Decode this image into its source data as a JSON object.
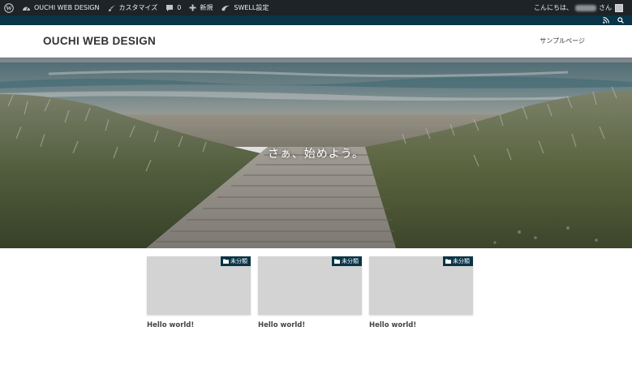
{
  "adminbar": {
    "wp_logo": "wordpress-icon",
    "site_name": "OUCHI WEB DESIGN",
    "customize": "カスタマイズ",
    "comments_count": "0",
    "new_label": "新規",
    "swell_settings": "SWELL設定",
    "greeting": "こんにちは、",
    "greeting_suffix": "さん"
  },
  "subbar": {
    "icons": [
      "rss-icon",
      "search-icon"
    ]
  },
  "header": {
    "site_title": "OUCHI WEB DESIGN",
    "nav": [
      "サンプルページ"
    ]
  },
  "hero": {
    "catchphrase": "さぁ、始めよう。"
  },
  "posts": [
    {
      "category": "未分類",
      "title": "Hello world!"
    },
    {
      "category": "未分類",
      "title": "Hello world!"
    },
    {
      "category": "未分類",
      "title": "Hello world!"
    }
  ],
  "colors": {
    "adminbar": "#1d2327",
    "accent": "#0a3447",
    "thumb": "#d3d3d3"
  }
}
